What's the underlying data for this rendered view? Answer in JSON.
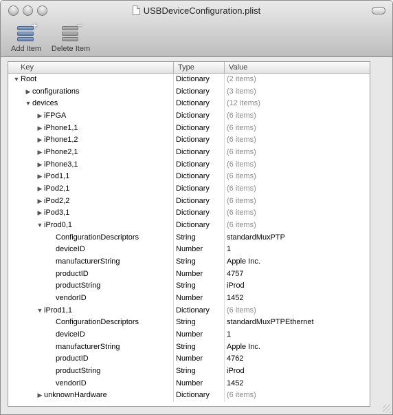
{
  "window": {
    "title": "USBDeviceConfiguration.plist"
  },
  "toolbar": {
    "add_label": "Add Item",
    "delete_label": "Delete Item"
  },
  "columns": {
    "key": "Key",
    "type": "Type",
    "value": "Value"
  },
  "rows": [
    {
      "key": "Root",
      "type": "Dictionary",
      "value": "(2 items)",
      "level": 0,
      "disclosure": "open",
      "muted": true
    },
    {
      "key": "configurations",
      "type": "Dictionary",
      "value": "(3 items)",
      "level": 1,
      "disclosure": "closed",
      "muted": true
    },
    {
      "key": "devices",
      "type": "Dictionary",
      "value": "(12 items)",
      "level": 1,
      "disclosure": "open",
      "muted": true
    },
    {
      "key": "iFPGA",
      "type": "Dictionary",
      "value": "(6 items)",
      "level": 2,
      "disclosure": "closed",
      "muted": true
    },
    {
      "key": "iPhone1,1",
      "type": "Dictionary",
      "value": "(6 items)",
      "level": 2,
      "disclosure": "closed",
      "muted": true
    },
    {
      "key": "iPhone1,2",
      "type": "Dictionary",
      "value": "(6 items)",
      "level": 2,
      "disclosure": "closed",
      "muted": true
    },
    {
      "key": "iPhone2,1",
      "type": "Dictionary",
      "value": "(6 items)",
      "level": 2,
      "disclosure": "closed",
      "muted": true
    },
    {
      "key": "iPhone3,1",
      "type": "Dictionary",
      "value": "(6 items)",
      "level": 2,
      "disclosure": "closed",
      "muted": true
    },
    {
      "key": "iPod1,1",
      "type": "Dictionary",
      "value": "(6 items)",
      "level": 2,
      "disclosure": "closed",
      "muted": true
    },
    {
      "key": "iPod2,1",
      "type": "Dictionary",
      "value": "(6 items)",
      "level": 2,
      "disclosure": "closed",
      "muted": true
    },
    {
      "key": "iPod2,2",
      "type": "Dictionary",
      "value": "(6 items)",
      "level": 2,
      "disclosure": "closed",
      "muted": true
    },
    {
      "key": "iPod3,1",
      "type": "Dictionary",
      "value": "(6 items)",
      "level": 2,
      "disclosure": "closed",
      "muted": true
    },
    {
      "key": "iProd0,1",
      "type": "Dictionary",
      "value": "(6 items)",
      "level": 2,
      "disclosure": "open",
      "muted": true
    },
    {
      "key": "ConfigurationDescriptors",
      "type": "String",
      "value": "standardMuxPTP",
      "level": 3,
      "disclosure": "none",
      "muted": false
    },
    {
      "key": "deviceID",
      "type": "Number",
      "value": "1",
      "level": 3,
      "disclosure": "none",
      "muted": false
    },
    {
      "key": "manufacturerString",
      "type": "String",
      "value": "Apple Inc.",
      "level": 3,
      "disclosure": "none",
      "muted": false
    },
    {
      "key": "productID",
      "type": "Number",
      "value": "4757",
      "level": 3,
      "disclosure": "none",
      "muted": false
    },
    {
      "key": "productString",
      "type": "String",
      "value": "iProd",
      "level": 3,
      "disclosure": "none",
      "muted": false
    },
    {
      "key": "vendorID",
      "type": "Number",
      "value": "1452",
      "level": 3,
      "disclosure": "none",
      "muted": false
    },
    {
      "key": "iProd1,1",
      "type": "Dictionary",
      "value": "(6 items)",
      "level": 2,
      "disclosure": "open",
      "muted": true
    },
    {
      "key": "ConfigurationDescriptors",
      "type": "String",
      "value": "standardMuxPTPEthernet",
      "level": 3,
      "disclosure": "none",
      "muted": false
    },
    {
      "key": "deviceID",
      "type": "Number",
      "value": "1",
      "level": 3,
      "disclosure": "none",
      "muted": false
    },
    {
      "key": "manufacturerString",
      "type": "String",
      "value": "Apple Inc.",
      "level": 3,
      "disclosure": "none",
      "muted": false
    },
    {
      "key": "productID",
      "type": "Number",
      "value": "4762",
      "level": 3,
      "disclosure": "none",
      "muted": false
    },
    {
      "key": "productString",
      "type": "String",
      "value": "iProd",
      "level": 3,
      "disclosure": "none",
      "muted": false
    },
    {
      "key": "vendorID",
      "type": "Number",
      "value": "1452",
      "level": 3,
      "disclosure": "none",
      "muted": false
    },
    {
      "key": "unknownHardware",
      "type": "Dictionary",
      "value": "(6 items)",
      "level": 2,
      "disclosure": "closed",
      "muted": true
    }
  ]
}
